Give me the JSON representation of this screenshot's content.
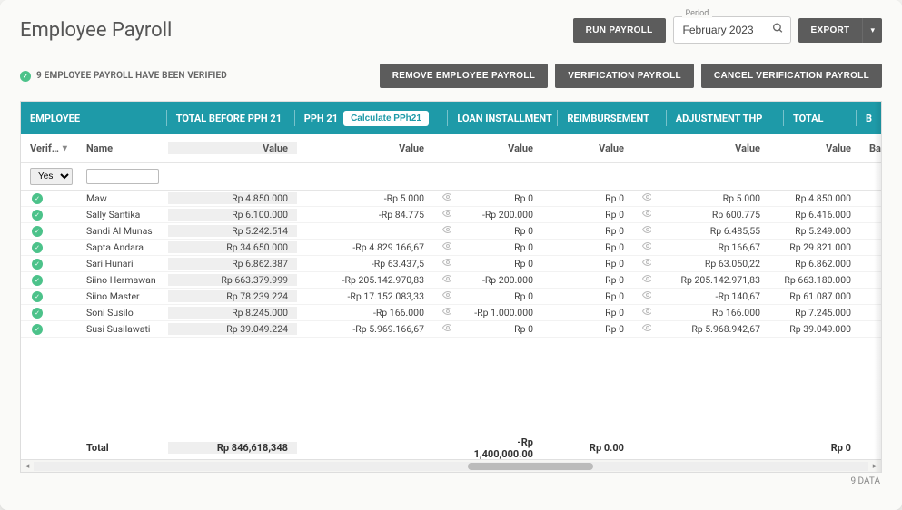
{
  "page": {
    "title": "Employee Payroll"
  },
  "actions": {
    "run_payroll": "RUN PAYROLL",
    "export": "EXPORT",
    "remove_employee_payroll": "REMOVE EMPLOYEE PAYROLL",
    "verification_payroll": "VERIFICATION PAYROLL",
    "cancel_verification_payroll": "CANCEL VERIFICATION PAYROLL",
    "calculate_pph21": "Calculate PPh21"
  },
  "period": {
    "label": "Period",
    "value": "February 2023"
  },
  "status": {
    "verified_count": 9,
    "verified_text": "9 EMPLOYEE PAYROLL HAVE BEEN VERIFIED"
  },
  "group_headers": {
    "employee": "EMPLOYEE",
    "total_before_pph21": "TOTAL BEFORE PPH 21",
    "pph21": "PPH 21",
    "loan_installment": "LOAN INSTALLMENT",
    "reimbursement": "REIMBURSEMENT",
    "adjustment_thp": "ADJUSTMENT THP",
    "total": "TOTAL",
    "extra": "B"
  },
  "col_headers": {
    "verif": "Verif…",
    "name": "Name",
    "value": "Value",
    "extra": "Ba"
  },
  "filters": {
    "verif_selected": "Yes",
    "name_filter": ""
  },
  "rows": [
    {
      "name": "Maw",
      "tbp": "Rp 4.850.000",
      "pph": "-Rp 5.000",
      "loan": "Rp 0",
      "reimb": "Rp 0",
      "adj": "Rp 5.000",
      "total": "Rp 4.850.000"
    },
    {
      "name": "Sally Santika",
      "tbp": "Rp 6.100.000",
      "pph": "-Rp 84.775",
      "loan": "-Rp 200.000",
      "reimb": "Rp 0",
      "adj": "Rp 600.775",
      "total": "Rp 6.416.000"
    },
    {
      "name": "Sandi Al Munas",
      "tbp": "Rp 5.242.514",
      "pph": "",
      "loan": "Rp 0",
      "reimb": "Rp 0",
      "adj": "Rp 6.485,55",
      "total": "Rp 5.249.000"
    },
    {
      "name": "Sapta Andara",
      "tbp": "Rp 34.650.000",
      "pph": "-Rp 4.829.166,67",
      "loan": "Rp 0",
      "reimb": "Rp 0",
      "adj": "Rp 166,67",
      "total": "Rp 29.821.000"
    },
    {
      "name": "Sari Hunari",
      "tbp": "Rp 6.862.387",
      "pph": "-Rp 63.437,5",
      "loan": "Rp 0",
      "reimb": "Rp 0",
      "adj": "Rp 63.050,22",
      "total": "Rp 6.862.000"
    },
    {
      "name": "Siino Hermawan",
      "tbp": "Rp 663.379.999",
      "pph": "-Rp 205.142.970,83",
      "loan": "-Rp 200.000",
      "reimb": "Rp 0",
      "adj": "Rp 205.142.971,83",
      "total": "Rp 663.180.000"
    },
    {
      "name": "Siino Master",
      "tbp": "Rp 78.239.224",
      "pph": "-Rp 17.152.083,33",
      "loan": "Rp 0",
      "reimb": "Rp 0",
      "adj": "-Rp 140,67",
      "total": "Rp 61.087.000"
    },
    {
      "name": "Soni Susilo",
      "tbp": "Rp 8.245.000",
      "pph": "-Rp 166.000",
      "loan": "-Rp 1.000.000",
      "reimb": "Rp 0",
      "adj": "Rp 166.000",
      "total": "Rp 7.245.000"
    },
    {
      "name": "Susi Susilawati",
      "tbp": "Rp 39.049.224",
      "pph": "-Rp 5.969.166,67",
      "loan": "Rp 0",
      "reimb": "Rp 0",
      "adj": "Rp 5.968.942,67",
      "total": "Rp 39.049.000"
    }
  ],
  "totals": {
    "label": "Total",
    "tbp": "Rp 846,618,348",
    "loan": "-Rp 1,400,000.00",
    "reimb": "Rp 0.00",
    "total": "Rp 0"
  },
  "footer": {
    "data_count": "9 DATA"
  }
}
